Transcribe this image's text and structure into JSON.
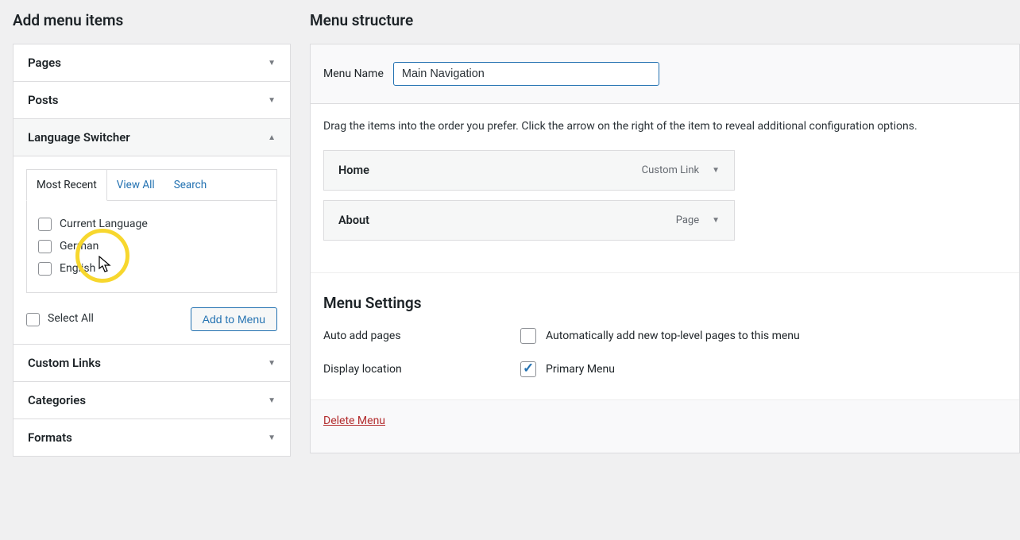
{
  "left": {
    "title": "Add menu items",
    "panels": {
      "pages": "Pages",
      "posts": "Posts",
      "language_switcher": "Language Switcher",
      "custom_links": "Custom Links",
      "categories": "Categories",
      "formats": "Formats"
    },
    "tabs": {
      "most_recent": "Most Recent",
      "view_all": "View All",
      "search": "Search"
    },
    "lang_options": {
      "current": "Current Language",
      "german": "German",
      "english": "English"
    },
    "select_all": "Select All",
    "add_to_menu": "Add to Menu"
  },
  "right": {
    "title": "Menu structure",
    "menu_name_label": "Menu Name",
    "menu_name_value": "Main Navigation",
    "instructions": "Drag the items into the order you prefer. Click the arrow on the right of the item to reveal additional configuration options.",
    "items": [
      {
        "title": "Home",
        "type": "Custom Link"
      },
      {
        "title": "About",
        "type": "Page"
      }
    ],
    "settings_title": "Menu Settings",
    "auto_add_label": "Auto add pages",
    "auto_add_option": "Automatically add new top-level pages to this menu",
    "display_loc_label": "Display location",
    "display_loc_option": "Primary Menu",
    "delete": "Delete Menu"
  }
}
